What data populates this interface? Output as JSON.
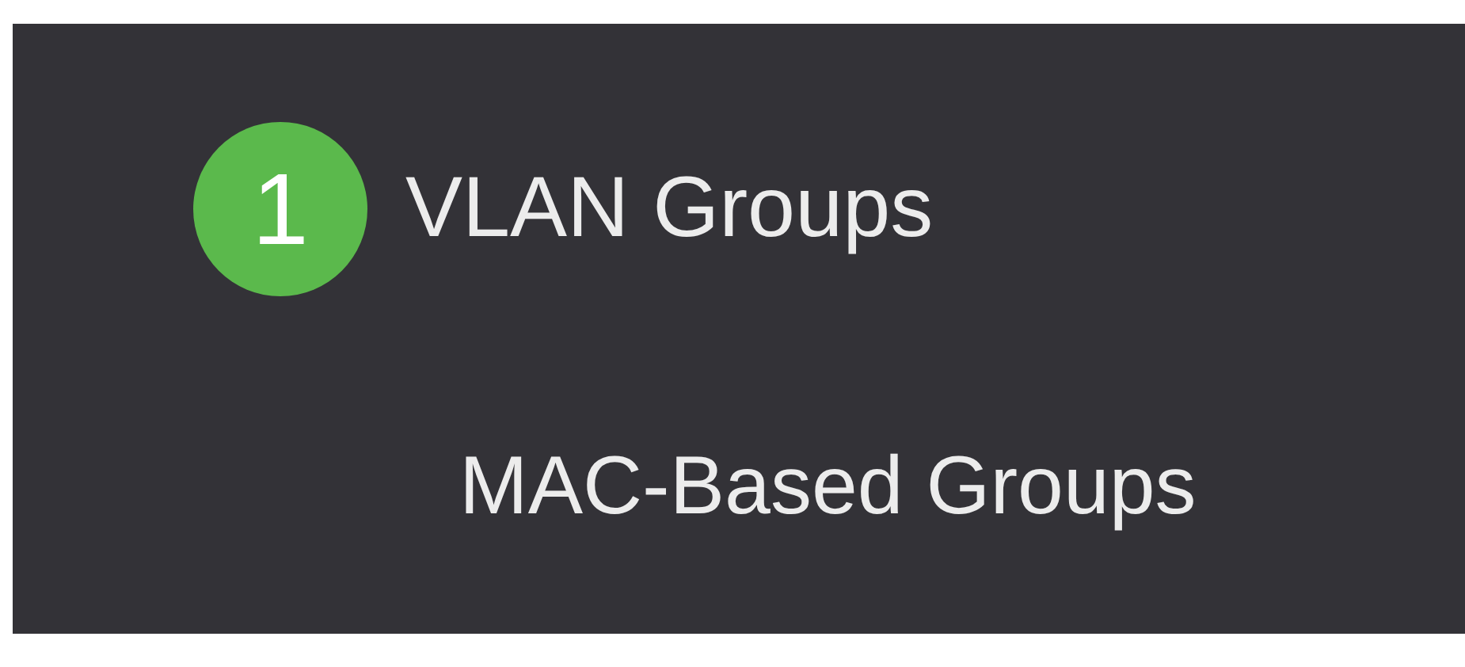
{
  "menu": {
    "items": [
      {
        "label": "VLAN Groups",
        "badge": "1",
        "children": [
          {
            "label": "MAC-Based Groups"
          }
        ]
      }
    ]
  }
}
